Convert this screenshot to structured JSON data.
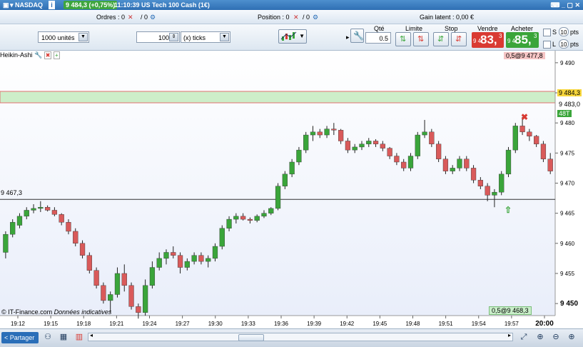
{
  "titlebar": {
    "market": "▾ NASDAQ",
    "price_change": "9 484,3 (+0,75%)",
    "time_instrument": "11:10:39 US Tech 100 Cash (1€)",
    "controls": "⌨ _ ▢ ✕"
  },
  "summary": {
    "orders": "Ordres : 0",
    "orders_total": "/ 0",
    "position": "Position : 0",
    "position_total": "/ 0",
    "gain": "Gain latent : 0,00 €"
  },
  "toolbar": {
    "units_value": "1000 unités",
    "ticks_value": "100",
    "ticks_unit": "(x) ticks",
    "qty_label": "Qté",
    "qty_value": "0.5",
    "limit_label": "Limite",
    "stop_label": "Stop",
    "sell_label": "Vendre",
    "buy_label": "Acheter",
    "sell_prefix": "9 4",
    "sell_big": "83,",
    "sell_sup": "3",
    "buy_prefix": "9 4",
    "buy_big": "85,",
    "buy_sup": "3",
    "s_label": "S",
    "l_label": "L",
    "s_pts": "10",
    "l_pts": "10",
    "pts_label": "pts"
  },
  "chart": {
    "indicator": "Heikin-Ashi",
    "top_order": "0,5@9 477,8",
    "bottom_order": "0,5@9 468,3",
    "current_price_tag": "9 484,3",
    "ask_tag": "9 483,0",
    "spread_tag": "48T",
    "line_label": "9 467,3",
    "copyright": "© IT-Finance.com",
    "disclaimer": "Données indicatives",
    "y_ticks": [
      "9 490",
      "9 485",
      "9 480",
      "9 475",
      "9 470",
      "9 465",
      "9 460",
      "9 455",
      "9 450"
    ],
    "x_ticks": [
      "19:12",
      "19:15",
      "19:18",
      "19:21",
      "19:24",
      "19:27",
      "19:30",
      "19:33",
      "19:36",
      "19:39",
      "19:42",
      "19:45",
      "19:48",
      "19:51",
      "19:54",
      "19:57",
      "20:00"
    ]
  },
  "chart_data": {
    "type": "candlestick",
    "ylim": [
      9448,
      9492
    ],
    "reference_line": 9467.3,
    "candles": [
      [
        9458.5,
        9462,
        9457.5,
        9461.5
      ],
      [
        9461.5,
        9464,
        9461,
        9463.5
      ],
      [
        9463,
        9465,
        9462.5,
        9464.5
      ],
      [
        9464.5,
        9466,
        9464,
        9465.5
      ],
      [
        9465.5,
        9466.5,
        9465,
        9465.8
      ],
      [
        9465.8,
        9467,
        9465.2,
        9466
      ],
      [
        9466,
        9466.3,
        9465.3,
        9465.5
      ],
      [
        9465.5,
        9466,
        9464.5,
        9464.8
      ],
      [
        9464.8,
        9465,
        9463,
        9463.5
      ],
      [
        9463.5,
        9464,
        9461.5,
        9462
      ],
      [
        9462,
        9462.5,
        9459.5,
        9460
      ],
      [
        9460,
        9460.5,
        9457.5,
        9458
      ],
      [
        9458,
        9458.5,
        9455,
        9455.5
      ],
      [
        9455.5,
        9456,
        9452.5,
        9453
      ],
      [
        9453,
        9453.5,
        9450,
        9450.5
      ],
      [
        9450.5,
        9452,
        9448.5,
        9451.5
      ],
      [
        9451.5,
        9456,
        9451,
        9455
      ],
      [
        9455,
        9456.5,
        9452,
        9453
      ],
      [
        9453,
        9453.5,
        9449,
        9449.5
      ],
      [
        9449.5,
        9450,
        9447.5,
        9448.5
      ],
      [
        9448.5,
        9454,
        9448,
        9453
      ],
      [
        9453,
        9457,
        9452.5,
        9456
      ],
      [
        9456,
        9458.5,
        9455.5,
        9457.5
      ],
      [
        9457.5,
        9459,
        9456.5,
        9458.5
      ],
      [
        9458.5,
        9459.5,
        9457.5,
        9458
      ],
      [
        9458,
        9458.5,
        9455,
        9456
      ],
      [
        9456,
        9457.5,
        9455.5,
        9457
      ],
      [
        9457,
        9458.5,
        9456.5,
        9458
      ],
      [
        9458,
        9458.5,
        9456.5,
        9457
      ],
      [
        9457,
        9458,
        9456,
        9457.5
      ],
      [
        9457.5,
        9460,
        9457,
        9459.5
      ],
      [
        9459.5,
        9463,
        9459,
        9462.5
      ],
      [
        9462.5,
        9464.5,
        9462,
        9464
      ],
      [
        9464,
        9465,
        9463.3,
        9464.5
      ],
      [
        9464.5,
        9465,
        9463.8,
        9464
      ],
      [
        9464,
        9464.3,
        9463.3,
        9463.8
      ],
      [
        9463.8,
        9464.8,
        9463.5,
        9464.5
      ],
      [
        9464.5,
        9465.5,
        9464.2,
        9465
      ],
      [
        9465,
        9466,
        9464.7,
        9465.8
      ],
      [
        9465.8,
        9470,
        9465.5,
        9469.5
      ],
      [
        9469.5,
        9472,
        9469,
        9471.5
      ],
      [
        9471.5,
        9474,
        9471,
        9473.5
      ],
      [
        9473.5,
        9476,
        9473,
        9475.5
      ],
      [
        9475.5,
        9478.5,
        9475,
        9478
      ],
      [
        9478,
        9479.5,
        9477,
        9478.5
      ],
      [
        9478.5,
        9479,
        9477.5,
        9478
      ],
      [
        9478,
        9479.5,
        9477.5,
        9479
      ],
      [
        9479,
        9480,
        9478,
        9478.8
      ],
      [
        9478.8,
        9479,
        9476.5,
        9477
      ],
      [
        9477,
        9477.5,
        9475,
        9475.5
      ],
      [
        9475.5,
        9476.5,
        9475,
        9476
      ],
      [
        9476,
        9477,
        9475.5,
        9476.5
      ],
      [
        9476.5,
        9477.5,
        9476,
        9477
      ],
      [
        9477,
        9477.3,
        9476,
        9476.5
      ],
      [
        9476.5,
        9477,
        9475.3,
        9475.8
      ],
      [
        9475.8,
        9476,
        9474,
        9474.5
      ],
      [
        9474.5,
        9475,
        9473,
        9473.5
      ],
      [
        9473.5,
        9474,
        9472,
        9472.5
      ],
      [
        9472.5,
        9475,
        9472,
        9474.5
      ],
      [
        9474.5,
        9478.5,
        9474,
        9478
      ],
      [
        9478,
        9480.5,
        9477.5,
        9478.5
      ],
      [
        9478.5,
        9479,
        9476,
        9476.5
      ],
      [
        9476.5,
        9477,
        9473.5,
        9474
      ],
      [
        9474,
        9474.5,
        9471.5,
        9472
      ],
      [
        9472,
        9473,
        9471.5,
        9472.5
      ],
      [
        9472.5,
        9474.5,
        9472,
        9474
      ],
      [
        9474,
        9474.5,
        9472,
        9472.5
      ],
      [
        9472.5,
        9473,
        9470,
        9470.5
      ],
      [
        9470.5,
        9471,
        9469,
        9469.5
      ],
      [
        9469.5,
        9470,
        9467,
        9468
      ],
      [
        9468,
        9469,
        9466,
        9468.5
      ],
      [
        9468.5,
        9472,
        9468,
        9471.5
      ],
      [
        9471.5,
        9476,
        9471,
        9475.5
      ],
      [
        9475.5,
        9480,
        9475,
        9479.5
      ],
      [
        9479.5,
        9481,
        9478,
        9478.5
      ],
      [
        9478.5,
        9479,
        9477,
        9477.8
      ],
      [
        9477.8,
        9478,
        9476,
        9476.5
      ],
      [
        9476.5,
        9477,
        9473.5,
        9474
      ],
      [
        9474,
        9475,
        9471.5,
        9472
      ]
    ]
  },
  "statusbar": {
    "share_label": "Partager"
  }
}
